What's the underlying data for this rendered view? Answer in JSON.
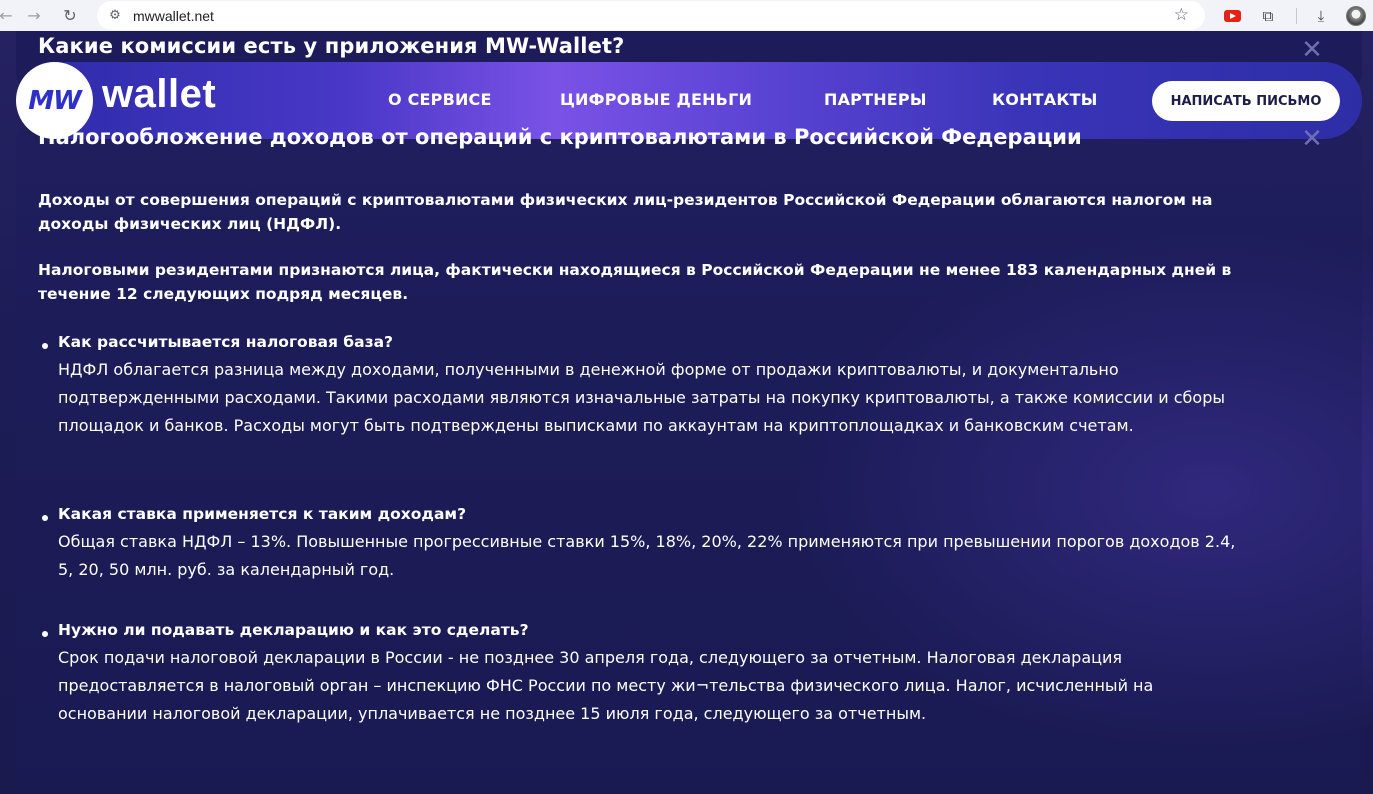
{
  "browser": {
    "url": "mwwallet.net",
    "back_icon": "←",
    "forward_icon": "→",
    "reload_icon": "↻",
    "site_icon": "⚙",
    "star_icon": "☆",
    "puzzle_icon": "⧉",
    "download_icon": "⤓"
  },
  "behind_card": {
    "title": "Какие комиссии есть у приложения MW-Wallet?",
    "close_glyph": "✕"
  },
  "header": {
    "logo_mark": "MW",
    "logo_word": "wallet",
    "nav": [
      "О СЕРВИСЕ",
      "ЦИФРОВЫЕ ДЕНЬГИ",
      "ПАРТНЕРЫ",
      "КОНТАКТЫ"
    ],
    "cta_label": "НАПИСАТЬ ПИСЬМО"
  },
  "card": {
    "title": "Налогообложение доходов от операций с криптовалютами в Российской Федерации",
    "close_glyph": "✕",
    "paragraphs": [
      "Доходы от совершения операций с криптовалютами физических лиц-резидентов Российской Федерации облагаются налогом на доходы физических лиц (НДФЛ).",
      "Налоговыми резидентами признаются лица, фактически находящиеся в Российской Федерации не менее 183 календарных дней в течение 12 следующих подряд месяцев."
    ],
    "faq": [
      {
        "question": "Как рассчитывается налоговая база?",
        "answer": "НДФЛ облагается разница между доходами, полученными в денежной форме от продажи криптовалюты, и документально подтвержденными расходами. Такими расходами являются изначальные затраты на покупку криптовалюты, а также комиссии и сборы площадок и банков. Расходы могут быть подтверждены выписками по аккаунтам на криптоплощадках и банковским счетам."
      },
      {
        "question": "Какая ставка применяется к таким доходам?",
        "answer": "Общая ставка НДФЛ – 13%. Повышенные прогрессивные ставки 15%, 18%, 20%, 22% применяются при превышении порогов доходов 2.4, 5, 20, 50 млн. руб. за календарный год."
      },
      {
        "question": "Нужно ли подавать декларацию и как это сделать?",
        "answer": "Срок подачи налоговой декларации в России - не позднее 30 апреля года, следующего за отчетным. Налоговая декларация предоставляется в налоговый орган – инспекцию ФНС России по месту жи¬тельства физического лица. Налог, исчисленный на основании налоговой декларации, уплачивается не позднее 15 июля года, следующего за отчетным."
      }
    ]
  }
}
